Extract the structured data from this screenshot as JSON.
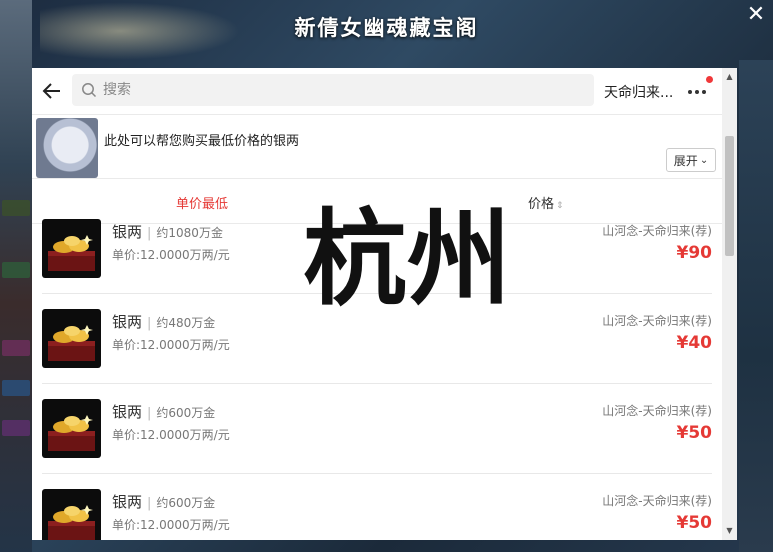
{
  "window": {
    "title": "新倩女幽魂藏宝阁",
    "close_glyph": "✕"
  },
  "header": {
    "back_icon": "arrow-left-icon",
    "search_placeholder": "搜索",
    "server_name": "天命归来...",
    "more_icon": "more-dots-icon"
  },
  "notice": {
    "text": "此处可以帮您购买最低价格的银两",
    "expand_label": "展开"
  },
  "sort": {
    "active_label": "单价最低",
    "price_label": "价格",
    "active_color": "#e53935"
  },
  "watermark": {
    "text": "杭州"
  },
  "items": [
    {
      "name": "银两",
      "amount": "约1080万金",
      "unit_price": "单价:12.0000万两/元",
      "server": "山河念-天命归来(荐)",
      "price": "¥90"
    },
    {
      "name": "银两",
      "amount": "约480万金",
      "unit_price": "单价:12.0000万两/元",
      "server": "山河念-天命归来(荐)",
      "price": "¥40"
    },
    {
      "name": "银两",
      "amount": "约600万金",
      "unit_price": "单价:12.0000万两/元",
      "server": "山河念-天命归来(荐)",
      "price": "¥50"
    },
    {
      "name": "银两",
      "amount": "约600万金",
      "unit_price": "单价:12.0000万两/元",
      "server": "山河念-天命归来(荐)",
      "price": "¥50"
    }
  ]
}
